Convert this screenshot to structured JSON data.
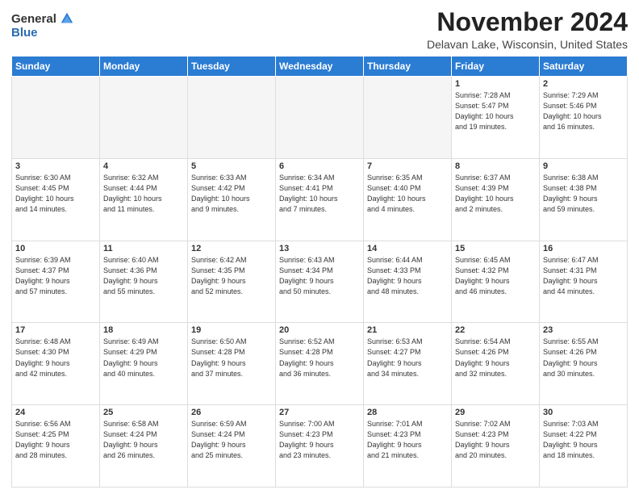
{
  "logo": {
    "general": "General",
    "blue": "Blue"
  },
  "title": "November 2024",
  "location": "Delavan Lake, Wisconsin, United States",
  "days_header": [
    "Sunday",
    "Monday",
    "Tuesday",
    "Wednesday",
    "Thursday",
    "Friday",
    "Saturday"
  ],
  "weeks": [
    [
      {
        "day": "",
        "info": ""
      },
      {
        "day": "",
        "info": ""
      },
      {
        "day": "",
        "info": ""
      },
      {
        "day": "",
        "info": ""
      },
      {
        "day": "",
        "info": ""
      },
      {
        "day": "1",
        "info": "Sunrise: 7:28 AM\nSunset: 5:47 PM\nDaylight: 10 hours\nand 19 minutes."
      },
      {
        "day": "2",
        "info": "Sunrise: 7:29 AM\nSunset: 5:46 PM\nDaylight: 10 hours\nand 16 minutes."
      }
    ],
    [
      {
        "day": "3",
        "info": "Sunrise: 6:30 AM\nSunset: 4:45 PM\nDaylight: 10 hours\nand 14 minutes."
      },
      {
        "day": "4",
        "info": "Sunrise: 6:32 AM\nSunset: 4:44 PM\nDaylight: 10 hours\nand 11 minutes."
      },
      {
        "day": "5",
        "info": "Sunrise: 6:33 AM\nSunset: 4:42 PM\nDaylight: 10 hours\nand 9 minutes."
      },
      {
        "day": "6",
        "info": "Sunrise: 6:34 AM\nSunset: 4:41 PM\nDaylight: 10 hours\nand 7 minutes."
      },
      {
        "day": "7",
        "info": "Sunrise: 6:35 AM\nSunset: 4:40 PM\nDaylight: 10 hours\nand 4 minutes."
      },
      {
        "day": "8",
        "info": "Sunrise: 6:37 AM\nSunset: 4:39 PM\nDaylight: 10 hours\nand 2 minutes."
      },
      {
        "day": "9",
        "info": "Sunrise: 6:38 AM\nSunset: 4:38 PM\nDaylight: 9 hours\nand 59 minutes."
      }
    ],
    [
      {
        "day": "10",
        "info": "Sunrise: 6:39 AM\nSunset: 4:37 PM\nDaylight: 9 hours\nand 57 minutes."
      },
      {
        "day": "11",
        "info": "Sunrise: 6:40 AM\nSunset: 4:36 PM\nDaylight: 9 hours\nand 55 minutes."
      },
      {
        "day": "12",
        "info": "Sunrise: 6:42 AM\nSunset: 4:35 PM\nDaylight: 9 hours\nand 52 minutes."
      },
      {
        "day": "13",
        "info": "Sunrise: 6:43 AM\nSunset: 4:34 PM\nDaylight: 9 hours\nand 50 minutes."
      },
      {
        "day": "14",
        "info": "Sunrise: 6:44 AM\nSunset: 4:33 PM\nDaylight: 9 hours\nand 48 minutes."
      },
      {
        "day": "15",
        "info": "Sunrise: 6:45 AM\nSunset: 4:32 PM\nDaylight: 9 hours\nand 46 minutes."
      },
      {
        "day": "16",
        "info": "Sunrise: 6:47 AM\nSunset: 4:31 PM\nDaylight: 9 hours\nand 44 minutes."
      }
    ],
    [
      {
        "day": "17",
        "info": "Sunrise: 6:48 AM\nSunset: 4:30 PM\nDaylight: 9 hours\nand 42 minutes."
      },
      {
        "day": "18",
        "info": "Sunrise: 6:49 AM\nSunset: 4:29 PM\nDaylight: 9 hours\nand 40 minutes."
      },
      {
        "day": "19",
        "info": "Sunrise: 6:50 AM\nSunset: 4:28 PM\nDaylight: 9 hours\nand 37 minutes."
      },
      {
        "day": "20",
        "info": "Sunrise: 6:52 AM\nSunset: 4:28 PM\nDaylight: 9 hours\nand 36 minutes."
      },
      {
        "day": "21",
        "info": "Sunrise: 6:53 AM\nSunset: 4:27 PM\nDaylight: 9 hours\nand 34 minutes."
      },
      {
        "day": "22",
        "info": "Sunrise: 6:54 AM\nSunset: 4:26 PM\nDaylight: 9 hours\nand 32 minutes."
      },
      {
        "day": "23",
        "info": "Sunrise: 6:55 AM\nSunset: 4:26 PM\nDaylight: 9 hours\nand 30 minutes."
      }
    ],
    [
      {
        "day": "24",
        "info": "Sunrise: 6:56 AM\nSunset: 4:25 PM\nDaylight: 9 hours\nand 28 minutes."
      },
      {
        "day": "25",
        "info": "Sunrise: 6:58 AM\nSunset: 4:24 PM\nDaylight: 9 hours\nand 26 minutes."
      },
      {
        "day": "26",
        "info": "Sunrise: 6:59 AM\nSunset: 4:24 PM\nDaylight: 9 hours\nand 25 minutes."
      },
      {
        "day": "27",
        "info": "Sunrise: 7:00 AM\nSunset: 4:23 PM\nDaylight: 9 hours\nand 23 minutes."
      },
      {
        "day": "28",
        "info": "Sunrise: 7:01 AM\nSunset: 4:23 PM\nDaylight: 9 hours\nand 21 minutes."
      },
      {
        "day": "29",
        "info": "Sunrise: 7:02 AM\nSunset: 4:23 PM\nDaylight: 9 hours\nand 20 minutes."
      },
      {
        "day": "30",
        "info": "Sunrise: 7:03 AM\nSunset: 4:22 PM\nDaylight: 9 hours\nand 18 minutes."
      }
    ]
  ]
}
